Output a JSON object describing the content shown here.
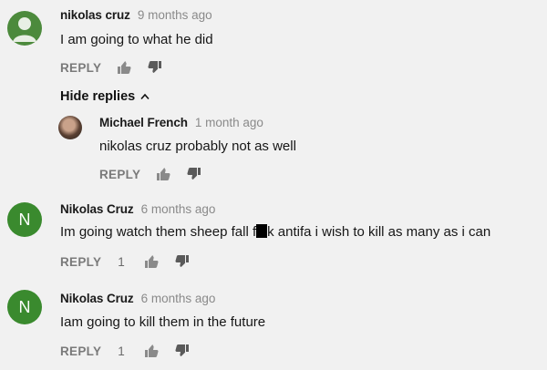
{
  "comments": [
    {
      "author": "nikolas cruz",
      "time": "9 months ago",
      "text": "I am going to what he did",
      "reply_label": "REPLY",
      "likes": "",
      "avatar": "default-avatar-icon"
    },
    {
      "author": "Michael French",
      "time": "1 month ago",
      "text": "nikolas cruz probably not as well",
      "reply_label": "REPLY",
      "likes": "",
      "avatar": "photo"
    },
    {
      "author": "Nikolas Cruz",
      "time": "6 months ago",
      "text_before": "Im going watch them sheep fall f",
      "text_after": "k antifa i wish to kill as many as i can",
      "reply_label": "REPLY",
      "likes": "1",
      "avatar_letter": "N"
    },
    {
      "author": "Nikolas Cruz",
      "time": "6 months ago",
      "text": "Iam going to kill them in the future",
      "reply_label": "REPLY",
      "likes": "1",
      "avatar_letter": "N"
    }
  ],
  "hide_replies_label": "Hide replies",
  "colors": {
    "avatar_green": "#3a8a2e",
    "background": "#f1f1f1"
  }
}
